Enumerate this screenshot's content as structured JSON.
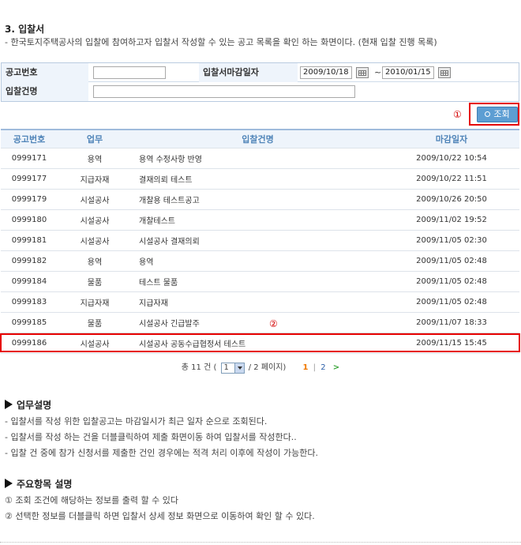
{
  "section": {
    "title": "3. 입찰서",
    "description": "- 한국토지주택공사의 입찰에 참여하고자 입찰서 작성할 수 있는 공고 목록을 확인 하는 화면이다. (현재 입찰 진행 목록)"
  },
  "search": {
    "notice_no_label": "공고번호",
    "notice_no_value": "",
    "deadline_label": "입찰서마감일자",
    "date_from": "2009/10/18",
    "date_sep": "~",
    "date_to": "2010/01/15",
    "bid_name_label": "입찰건명",
    "bid_name_value": "",
    "search_button": "조회",
    "marker": "①"
  },
  "table": {
    "headers": [
      "공고번호",
      "업무",
      "입찰건명",
      "마감일자"
    ],
    "rows": [
      [
        "0999171",
        "용역",
        "용역 수정사항 반영",
        "2009/10/22 10:54"
      ],
      [
        "0999177",
        "지급자재",
        "결재의뢰 테스트",
        "2009/10/22 11:51"
      ],
      [
        "0999179",
        "시설공사",
        "개찰용 테스트공고",
        "2009/10/26 20:50"
      ],
      [
        "0999180",
        "시설공사",
        "개찰테스트",
        "2009/11/02 19:52"
      ],
      [
        "0999181",
        "시설공사",
        "시설공사 결재의뢰",
        "2009/11/05 02:30"
      ],
      [
        "0999182",
        "용역",
        "용역",
        "2009/11/05 02:48"
      ],
      [
        "0999184",
        "물품",
        "테스트 물품",
        "2009/11/05 02:48"
      ],
      [
        "0999183",
        "지급자재",
        "지급자재",
        "2009/11/05 02:48"
      ],
      [
        "0999185",
        "물품",
        "시설공사 긴급발주",
        "2009/11/07 18:33"
      ],
      [
        "0999186",
        "시설공사",
        "시설공사 공동수급협정서 테스트",
        "2009/11/15 15:45"
      ]
    ],
    "marker": "②"
  },
  "pager": {
    "total_prefix": "총 11 건 (",
    "page_select": "1",
    "total_suffix": "/ 2 페이지)",
    "page1": "1",
    "sep": "|",
    "page2": "2",
    "next": ">"
  },
  "work_desc": {
    "title": "업무설명",
    "lines": [
      "- 입찰서를 작성 위한 입찰공고는 마감일시가 최근 일자 순으로 조회된다.",
      "- 입찰서를 작성 하는 건을 더블클릭하여 제출 화면이동 하여 입찰서를 작성한다..",
      "- 입찰 건 중에 참가 신청서를 제출한 건인 경우에는 적격 처리 이후에 작성이 가능한다."
    ]
  },
  "item_desc": {
    "title": "주요항목 설명",
    "lines": [
      "① 조회 조건에 해당하는 정보를 출력 할 수 있다",
      "② 선택한 정보를 더블클릭 하면 입찰서 상세 정보 화면으로 이동하여 확인 할 수 있다."
    ]
  }
}
